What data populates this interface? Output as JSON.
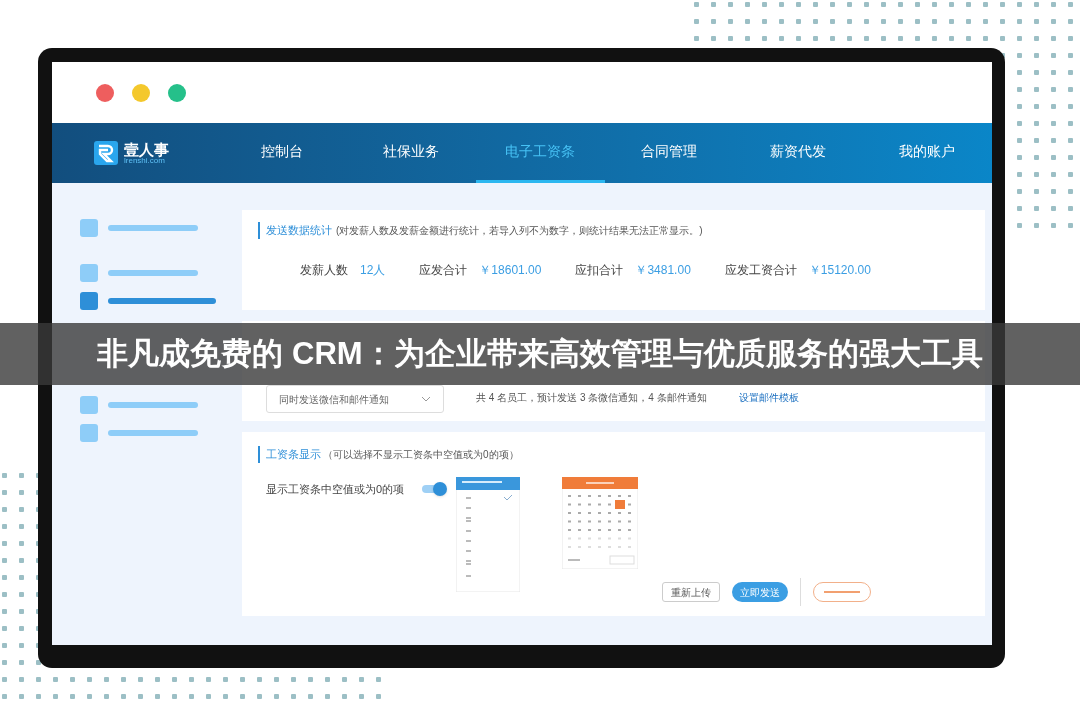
{
  "window": {
    "controls": [
      {
        "color": "#ee5e5e"
      },
      {
        "color": "#f4c82c"
      },
      {
        "color": "#25c08a"
      }
    ]
  },
  "logo": {
    "name": "壹人事",
    "domain": "lrenshi.com"
  },
  "nav": [
    {
      "label": "控制台",
      "selected": false
    },
    {
      "label": "社保业务",
      "selected": false
    },
    {
      "label": "电子工资条",
      "selected": true
    },
    {
      "label": "合同管理",
      "selected": false
    },
    {
      "label": "薪资代发",
      "selected": false
    },
    {
      "label": "我的账户",
      "selected": false
    }
  ],
  "sidebar": {
    "items": [
      {
        "selected": false
      },
      {
        "selected": false
      },
      {
        "selected": true
      },
      {
        "selected": false
      },
      {
        "selected": false
      }
    ]
  },
  "stats_card": {
    "title": "发送数据统计",
    "note": "(对发薪人数及发薪金额进行统计，若导入列不为数字，则统计结果无法正常显示。)",
    "stats": [
      {
        "label": "发薪人数",
        "value": "12人"
      },
      {
        "label": "应发合计",
        "value": "￥18601.00"
      },
      {
        "label": "应扣合计",
        "value": "￥3481.00"
      },
      {
        "label": "应发工资合计",
        "value": "￥15120.00"
      }
    ]
  },
  "send_card": {
    "select": {
      "value": "同时发送微信和邮件通知"
    },
    "summary": "共 4 名员工，预计发送 3 条微信通知，4 条邮件通知",
    "link": "设置邮件模板"
  },
  "display_card": {
    "title": "工资条显示",
    "note": "（可以选择不显示工资条中空值或为0的项）",
    "toggle": {
      "label": "显示工资条中空值或为0的项",
      "on": true
    },
    "buttons": [
      {
        "label": "重新上传",
        "kind": "outline"
      },
      {
        "label": "立即发送",
        "kind": "primary"
      }
    ]
  },
  "banner": {
    "text": "非凡成免费的 CRM：为企业带来高效管理与优质服务的强大工具"
  }
}
